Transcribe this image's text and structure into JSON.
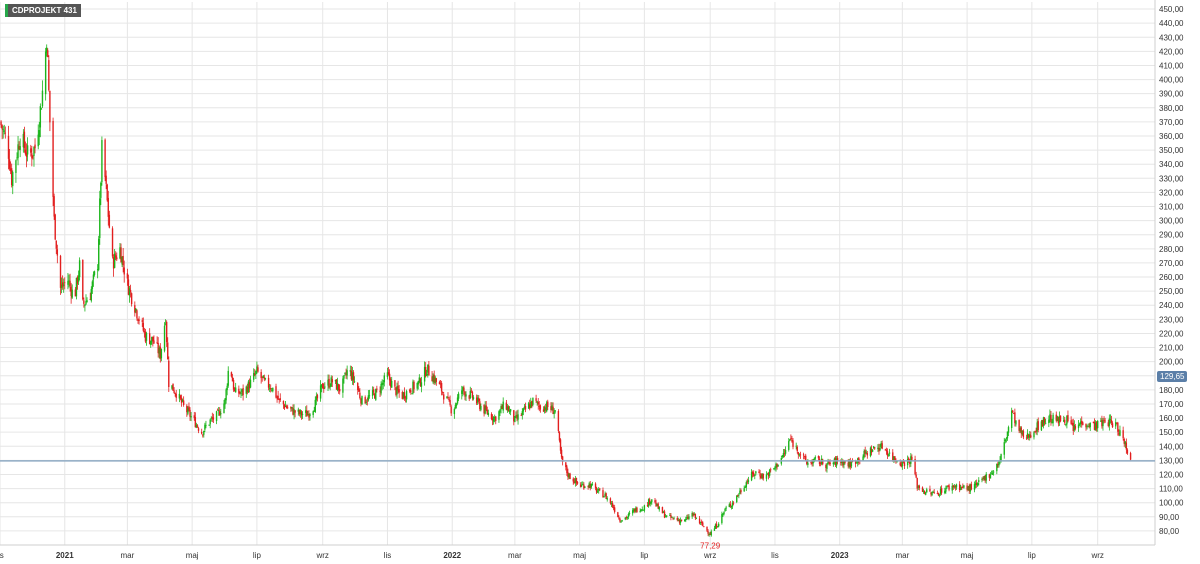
{
  "ticker": "CDPROJEKT",
  "badge_value": "431",
  "last_price_label": "129,65",
  "colors": {
    "up": "#1bb41b",
    "down": "#e21e1e",
    "grid": "#e6e6e6",
    "price_line": "#8faac4"
  },
  "chart_data": {
    "type": "candlestick",
    "title": "",
    "xlabel": "",
    "ylabel": "",
    "ylim": [
      70,
      455
    ],
    "y_ticks": [
      80,
      90,
      100,
      110,
      120,
      130,
      140,
      150,
      160,
      170,
      180,
      190,
      200,
      210,
      220,
      230,
      240,
      250,
      260,
      270,
      280,
      290,
      300,
      310,
      320,
      330,
      340,
      350,
      360,
      370,
      380,
      390,
      400,
      410,
      420,
      430,
      440,
      450
    ],
    "y_tick_labels": [
      "80,00",
      "90,00",
      "100,00",
      "110,00",
      "120,00",
      "130,00",
      "140,00",
      "150,00",
      "160,00",
      "170,00",
      "180,00",
      "190,00",
      "200,00",
      "210,00",
      "220,00",
      "230,00",
      "240,00",
      "250,00",
      "260,00",
      "270,00",
      "280,00",
      "290,00",
      "300,00",
      "310,00",
      "320,00",
      "330,00",
      "340,00",
      "350,00",
      "360,00",
      "370,00",
      "380,00",
      "390,00",
      "400,00",
      "410,00",
      "420,00",
      "430,00",
      "440,00",
      "450,00"
    ],
    "x_range": [
      "2020-11-01",
      "2023-10-25"
    ],
    "x_ticks": [
      {
        "date": "2020-11-01",
        "label": "lis",
        "bold": false
      },
      {
        "date": "2021-01-01",
        "label": "2021",
        "bold": true
      },
      {
        "date": "2021-03-01",
        "label": "mar",
        "bold": false
      },
      {
        "date": "2021-05-01",
        "label": "maj",
        "bold": false
      },
      {
        "date": "2021-07-01",
        "label": "lip",
        "bold": false
      },
      {
        "date": "2021-09-01",
        "label": "wrz",
        "bold": false
      },
      {
        "date": "2021-11-01",
        "label": "lis",
        "bold": false
      },
      {
        "date": "2022-01-01",
        "label": "2022",
        "bold": true
      },
      {
        "date": "2022-03-01",
        "label": "mar",
        "bold": false
      },
      {
        "date": "2022-05-01",
        "label": "maj",
        "bold": false
      },
      {
        "date": "2022-07-01",
        "label": "lip",
        "bold": false
      },
      {
        "date": "2022-09-01",
        "label": "wrz",
        "bold": false
      },
      {
        "date": "2022-11-01",
        "label": "lis",
        "bold": false
      },
      {
        "date": "2023-01-01",
        "label": "2023",
        "bold": true
      },
      {
        "date": "2023-03-01",
        "label": "mar",
        "bold": false
      },
      {
        "date": "2023-05-01",
        "label": "maj",
        "bold": false
      },
      {
        "date": "2023-07-01",
        "label": "lip",
        "bold": false
      },
      {
        "date": "2023-09-01",
        "label": "wrz",
        "bold": false
      }
    ],
    "grid": true,
    "last_price": 129.65,
    "min_point": {
      "date": "2022-09-01",
      "value": 77.29,
      "label": "77,29"
    },
    "close_path": [
      [
        "2020-11-01",
        370
      ],
      [
        "2020-11-08",
        355
      ],
      [
        "2020-11-12",
        330
      ],
      [
        "2020-11-20",
        360
      ],
      [
        "2020-11-28",
        345
      ],
      [
        "2020-12-04",
        352
      ],
      [
        "2020-12-08",
        372
      ],
      [
        "2020-12-12",
        398
      ],
      [
        "2020-12-15",
        431
      ],
      [
        "2020-12-18",
        370
      ],
      [
        "2020-12-22",
        300
      ],
      [
        "2020-12-28",
        252
      ],
      [
        "2021-01-04",
        258
      ],
      [
        "2021-01-10",
        245
      ],
      [
        "2021-01-15",
        268
      ],
      [
        "2021-01-18",
        240
      ],
      [
        "2021-01-25",
        248
      ],
      [
        "2021-02-01",
        270
      ],
      [
        "2021-02-05",
        350
      ],
      [
        "2021-02-08",
        330
      ],
      [
        "2021-02-15",
        270
      ],
      [
        "2021-02-22",
        280
      ],
      [
        "2021-03-01",
        255
      ],
      [
        "2021-03-10",
        235
      ],
      [
        "2021-03-18",
        218
      ],
      [
        "2021-03-25",
        215
      ],
      [
        "2021-04-01",
        205
      ],
      [
        "2021-04-06",
        232
      ],
      [
        "2021-04-09",
        185
      ],
      [
        "2021-04-16",
        178
      ],
      [
        "2021-04-23",
        168
      ],
      [
        "2021-05-01",
        160
      ],
      [
        "2021-05-10",
        150
      ],
      [
        "2021-05-18",
        158
      ],
      [
        "2021-05-25",
        162
      ],
      [
        "2021-06-01",
        172
      ],
      [
        "2021-06-05",
        200
      ],
      [
        "2021-06-10",
        178
      ],
      [
        "2021-06-18",
        178
      ],
      [
        "2021-06-25",
        185
      ],
      [
        "2021-07-01",
        193
      ],
      [
        "2021-07-08",
        185
      ],
      [
        "2021-07-15",
        182
      ],
      [
        "2021-07-22",
        172
      ],
      [
        "2021-08-01",
        166
      ],
      [
        "2021-08-10",
        163
      ],
      [
        "2021-08-18",
        163
      ],
      [
        "2021-08-25",
        170
      ],
      [
        "2021-09-01",
        183
      ],
      [
        "2021-09-10",
        186
      ],
      [
        "2021-09-18",
        180
      ],
      [
        "2021-09-25",
        195
      ],
      [
        "2021-10-01",
        186
      ],
      [
        "2021-10-08",
        172
      ],
      [
        "2021-10-15",
        175
      ],
      [
        "2021-10-22",
        178
      ],
      [
        "2021-11-01",
        190
      ],
      [
        "2021-11-08",
        180
      ],
      [
        "2021-11-15",
        176
      ],
      [
        "2021-11-25",
        182
      ],
      [
        "2021-12-01",
        185
      ],
      [
        "2021-12-08",
        195
      ],
      [
        "2021-12-15",
        188
      ],
      [
        "2021-12-22",
        180
      ],
      [
        "2022-01-01",
        165
      ],
      [
        "2022-01-10",
        180
      ],
      [
        "2022-01-20",
        175
      ],
      [
        "2022-02-01",
        165
      ],
      [
        "2022-02-10",
        160
      ],
      [
        "2022-02-20",
        170
      ],
      [
        "2022-03-01",
        158
      ],
      [
        "2022-03-10",
        165
      ],
      [
        "2022-03-18",
        172
      ],
      [
        "2022-03-25",
        168
      ],
      [
        "2022-04-01",
        168
      ],
      [
        "2022-04-08",
        165
      ],
      [
        "2022-04-14",
        130
      ],
      [
        "2022-04-20",
        120
      ],
      [
        "2022-05-01",
        112
      ],
      [
        "2022-05-10",
        113
      ],
      [
        "2022-05-18",
        108
      ],
      [
        "2022-05-25",
        105
      ],
      [
        "2022-06-01",
        98
      ],
      [
        "2022-06-08",
        88
      ],
      [
        "2022-06-15",
        90
      ],
      [
        "2022-06-22",
        95
      ],
      [
        "2022-07-01",
        97
      ],
      [
        "2022-07-08",
        103
      ],
      [
        "2022-07-15",
        95
      ],
      [
        "2022-07-22",
        90
      ],
      [
        "2022-08-01",
        88
      ],
      [
        "2022-08-08",
        87
      ],
      [
        "2022-08-15",
        92
      ],
      [
        "2022-08-22",
        86
      ],
      [
        "2022-09-01",
        78
      ],
      [
        "2022-09-08",
        85
      ],
      [
        "2022-09-15",
        95
      ],
      [
        "2022-09-22",
        100
      ],
      [
        "2022-10-01",
        110
      ],
      [
        "2022-10-08",
        118
      ],
      [
        "2022-10-15",
        122
      ],
      [
        "2022-10-22",
        118
      ],
      [
        "2022-11-01",
        125
      ],
      [
        "2022-11-10",
        135
      ],
      [
        "2022-11-15",
        145
      ],
      [
        "2022-11-22",
        138
      ],
      [
        "2022-12-01",
        128
      ],
      [
        "2022-12-10",
        130
      ],
      [
        "2022-12-20",
        127
      ],
      [
        "2023-01-01",
        130
      ],
      [
        "2023-01-10",
        127
      ],
      [
        "2023-01-20",
        132
      ],
      [
        "2023-02-01",
        138
      ],
      [
        "2023-02-10",
        140
      ],
      [
        "2023-02-20",
        132
      ],
      [
        "2023-03-01",
        128
      ],
      [
        "2023-03-10",
        131
      ],
      [
        "2023-03-15",
        112
      ],
      [
        "2023-03-22",
        108
      ],
      [
        "2023-04-01",
        106
      ],
      [
        "2023-04-10",
        110
      ],
      [
        "2023-04-20",
        112
      ],
      [
        "2023-05-01",
        110
      ],
      [
        "2023-05-10",
        112
      ],
      [
        "2023-05-18",
        118
      ],
      [
        "2023-05-25",
        122
      ],
      [
        "2023-06-01",
        130
      ],
      [
        "2023-06-08",
        150
      ],
      [
        "2023-06-12",
        165
      ],
      [
        "2023-06-18",
        152
      ],
      [
        "2023-06-25",
        145
      ],
      [
        "2023-07-01",
        150
      ],
      [
        "2023-07-10",
        157
      ],
      [
        "2023-07-18",
        160
      ],
      [
        "2023-07-25",
        158
      ],
      [
        "2023-08-01",
        160
      ],
      [
        "2023-08-10",
        152
      ],
      [
        "2023-08-18",
        158
      ],
      [
        "2023-08-25",
        155
      ],
      [
        "2023-09-01",
        155
      ],
      [
        "2023-09-10",
        158
      ],
      [
        "2023-09-18",
        155
      ],
      [
        "2023-09-22",
        150
      ],
      [
        "2023-09-28",
        140
      ],
      [
        "2023-10-02",
        129.65
      ]
    ]
  }
}
